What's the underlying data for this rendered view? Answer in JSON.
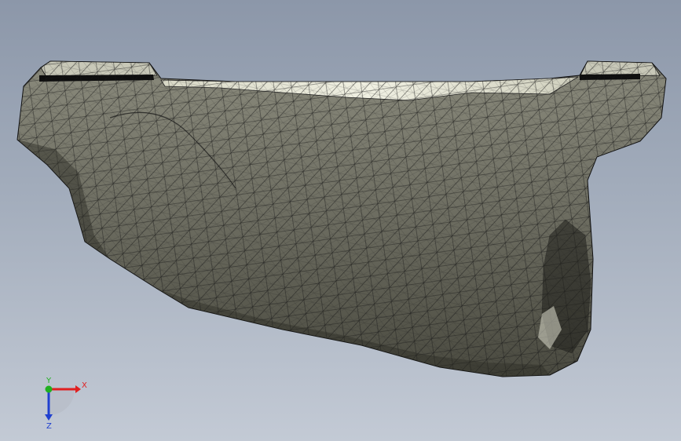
{
  "viewport": {
    "background_top": "#8c97a9",
    "background_bottom": "#c3cad5"
  },
  "model": {
    "display_style": "wireframe-shaded",
    "face_color": "#6f6f62",
    "top_face_color": "#e8e8d8",
    "edge_color": "#1a1a1a"
  },
  "triad": {
    "x_label": "X",
    "y_label": "Y",
    "z_label": "Z",
    "x_color": "#e02020",
    "y_color": "#20b020",
    "z_color": "#2040d0"
  }
}
